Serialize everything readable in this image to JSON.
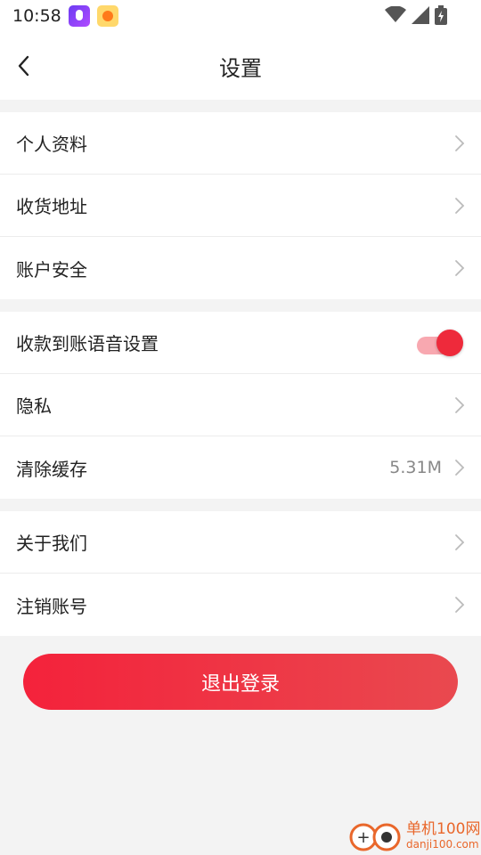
{
  "status_bar": {
    "time": "10:58",
    "icons": [
      "podcast-app-icon",
      "weather-app-icon",
      "wifi-icon",
      "signal-icon",
      "battery-icon"
    ]
  },
  "header": {
    "title": "设置",
    "back_icon": "chevron-left-icon"
  },
  "settings": {
    "group1": [
      {
        "label": "个人资料"
      },
      {
        "label": "收货地址"
      },
      {
        "label": "账户安全"
      }
    ],
    "group2": [
      {
        "label": "收款到账语音设置",
        "toggle_on": true
      },
      {
        "label": "隐私"
      },
      {
        "label": "清除缓存",
        "value": "5.31M"
      }
    ],
    "group3": [
      {
        "label": "关于我们"
      },
      {
        "label": "注销账号"
      }
    ]
  },
  "logout_label": "退出登录",
  "watermark": {
    "cn": "单机100网",
    "en": "danji100.com"
  },
  "colors": {
    "accent": "#ee2a3b",
    "toggle_track": "#f8a8b0",
    "background": "#f3f3f3"
  }
}
